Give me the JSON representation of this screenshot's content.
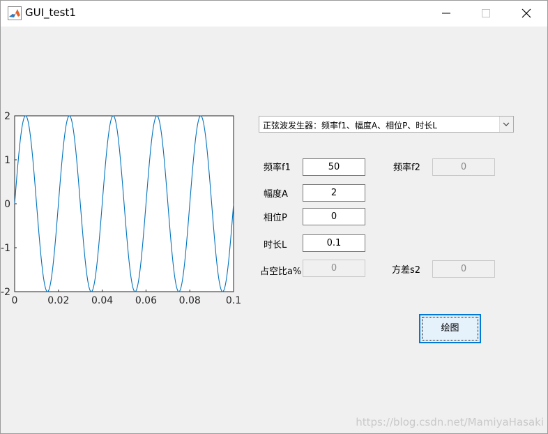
{
  "window": {
    "title": "GUI_test1",
    "app_icon": "matlab-icon",
    "controls": [
      "minimize-icon",
      "maximize-icon",
      "close-icon"
    ]
  },
  "chart_data": {
    "type": "line",
    "function": "2*sin(2*pi*50*t)",
    "frequency": 50,
    "amplitude": 2,
    "phase": 0,
    "xlim": [
      0,
      0.1
    ],
    "ylim": [
      -2,
      2
    ],
    "xticks": [
      "0",
      "0.02",
      "0.04",
      "0.06",
      "0.08",
      "0.1"
    ],
    "yticks": [
      "2",
      "1",
      "0",
      "-1",
      "-2"
    ],
    "line_color": "#0072bd",
    "grid": false
  },
  "dropdown": {
    "selected": "正弦波发生器：频率f1、幅度A、相位P、时长L"
  },
  "fields": {
    "f1": {
      "label": "频率f1",
      "value": "50"
    },
    "f2": {
      "label": "频率f2",
      "value": "0"
    },
    "amp": {
      "label": "幅度A",
      "value": "2"
    },
    "phase": {
      "label": "相位P",
      "value": "0"
    },
    "len": {
      "label": "时长L",
      "value": "0.1"
    },
    "duty": {
      "label": "占空比a%",
      "value": "0"
    },
    "var": {
      "label": "方差s2",
      "value": "0"
    }
  },
  "plot_button": {
    "label": "绘图"
  },
  "watermark": "https://blog.csdn.net/MamiyaHasaki"
}
